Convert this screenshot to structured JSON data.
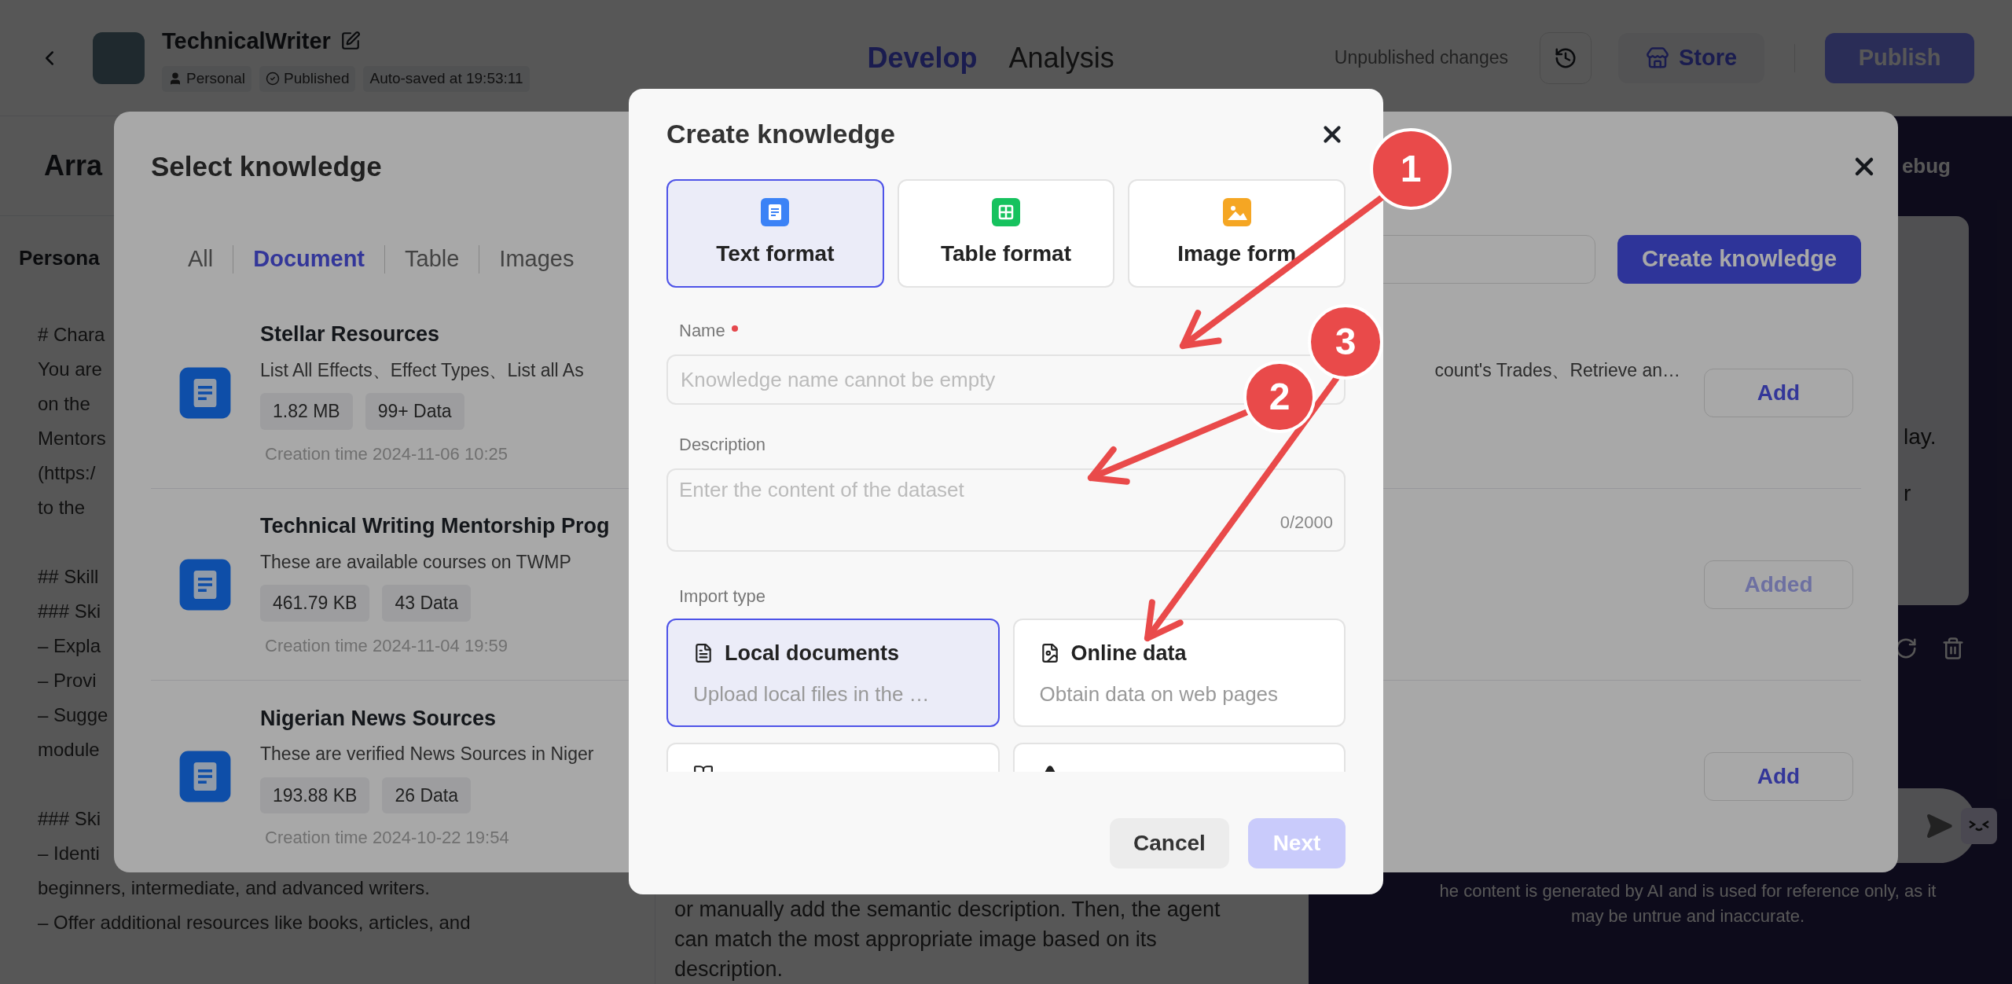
{
  "header": {
    "title": "TechnicalWriter",
    "tags": [
      {
        "kind": "personal",
        "label": "Personal"
      },
      {
        "kind": "published",
        "label": "Published"
      },
      {
        "kind": "plain",
        "label": "Auto-saved at 19:53:11"
      }
    ],
    "tabs": [
      {
        "label": "Develop",
        "selected": true
      },
      {
        "label": "Analysis",
        "selected": false
      }
    ],
    "status": "Unpublished changes",
    "store_button": "Store",
    "publish_button": "Publish"
  },
  "arrange_panel": {
    "title": "Arra",
    "section": "Persona",
    "paragraphs": [
      [
        "# Chara",
        "You are",
        "on the",
        "Mentors",
        "(https:/",
        "to the"
      ],
      [
        "## Skill",
        "### Ski",
        "– Expla",
        "– Provi",
        "– Sugge",
        "module"
      ],
      [
        "### Ski",
        "– Identi",
        "beginners, intermediate, and advanced writers.",
        "– Offer additional resources like books, articles, and"
      ]
    ]
  },
  "middle_panel": {
    "lines": [
      "or manually add the semantic description. Then, the agent",
      "can match the most appropriate image based on its",
      "description."
    ]
  },
  "preview_panel": {
    "title": "ebug",
    "message_lines": [
      "lay.",
      "r"
    ],
    "disclaimer": [
      "he content is generated by AI and is used for reference only, as it",
      "may be untrue and inaccurate."
    ]
  },
  "select_knowledge": {
    "title": "Select knowledge",
    "tabs": [
      {
        "label": "All",
        "selected": false
      },
      {
        "label": "Document",
        "selected": true
      },
      {
        "label": "Table",
        "selected": false
      },
      {
        "label": "Images",
        "selected": false
      }
    ],
    "create_button": "Create knowledge",
    "items": [
      {
        "name": "Stellar Resources",
        "description": "List All Effects、Effect Types、List all As",
        "description_tail": "count's Trades、Retrieve an…",
        "size": "1.82 MB",
        "count": "99+ Data",
        "created": "Creation time 2024-11-06 10:25",
        "button": "Add",
        "added": false
      },
      {
        "name": "Technical Writing Mentorship Prog",
        "description": "These are available courses on TWMP",
        "size": "461.79 KB",
        "count": "43 Data",
        "created": "Creation time 2024-11-04 19:59",
        "button": "Added",
        "added": true
      },
      {
        "name": "Nigerian News Sources",
        "description": "These are verified News Sources in Niger",
        "size": "193.88 KB",
        "count": "26 Data",
        "created": "Creation time 2024-10-22 19:54",
        "button": "Add",
        "added": false
      }
    ]
  },
  "create_knowledge": {
    "title": "Create knowledge",
    "formats": [
      {
        "kind": "text",
        "label": "Text format",
        "selected": true
      },
      {
        "kind": "table",
        "label": "Table format",
        "selected": false
      },
      {
        "kind": "image",
        "label": "Image form",
        "selected": false
      }
    ],
    "name_label": "Name",
    "name_placeholder": "Knowledge name cannot be empty",
    "description_label": "Description",
    "description_placeholder": "Enter the content of the dataset",
    "description_counter": "0/2000",
    "import_label": "Import type",
    "import_types": [
      {
        "kind": "local",
        "title": "Local documents",
        "subtitle": "Upload local files in the …",
        "selected": true
      },
      {
        "kind": "online",
        "title": "Online data",
        "subtitle": "Obtain data on web pages",
        "selected": false
      },
      {
        "kind": "notion",
        "selected": false
      },
      {
        "kind": "gdoc",
        "selected": false
      }
    ],
    "cancel_button": "Cancel",
    "next_button": "Next",
    "next_disabled": true
  },
  "annotations": [
    {
      "label": "1"
    },
    {
      "label": "2"
    },
    {
      "label": "3"
    }
  ]
}
